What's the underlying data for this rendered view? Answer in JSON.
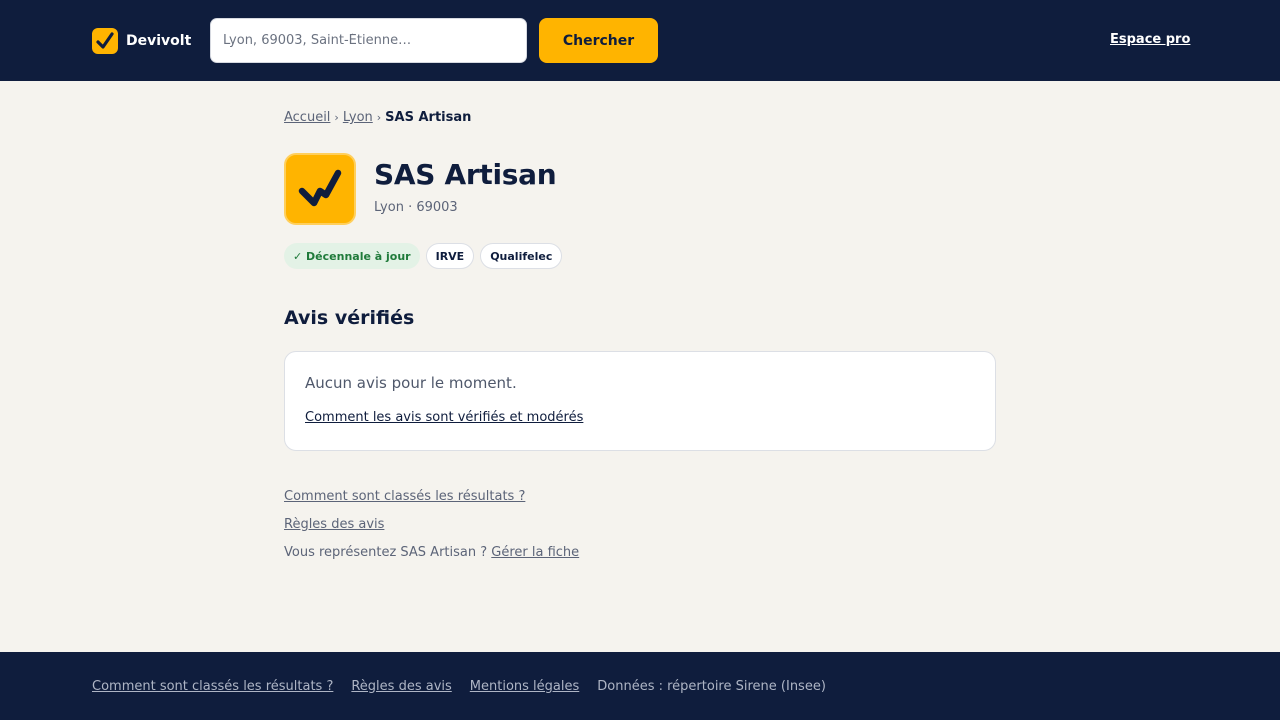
{
  "colors": {
    "navy": "#0f1d3d",
    "accent": "#ffb400",
    "background": "#f5f3ee",
    "success": "#1f7a3a"
  },
  "header": {
    "brand_name": "Devivolt",
    "logo_icon": "check-bolt-icon",
    "search_placeholder": "Lyon, 69003, Saint-Étienne…",
    "search_value": "",
    "search_button": "Chercher",
    "pro_link": "Espace pro"
  },
  "breadcrumb": {
    "home": "Accueil",
    "separator_1": "›",
    "city": "Lyon",
    "separator_2": "›",
    "current": "SAS Artisan"
  },
  "company": {
    "name": "SAS Artisan",
    "location": "Lyon · 69003",
    "logo_icon": "check-bolt-icon",
    "badges": {
      "decennale": "✓ Décennale à jour",
      "irve": "IRVE",
      "qualifelec": "Qualifelec"
    }
  },
  "reviews": {
    "title": "Avis vérifiés",
    "empty_text": "Aucun avis pour le moment.",
    "how_link": "Comment les avis sont vérifiés et modérés"
  },
  "links": {
    "ranking": "Comment sont classés les résultats ?",
    "rules": "Règles des avis",
    "represent_text": "Vous représentez SAS Artisan ?",
    "manage": "Gérer la fiche"
  },
  "footer": {
    "ranking": "Comment sont classés les résultats ?",
    "rules": "Règles des avis",
    "legal": "Mentions légales",
    "data_source": "Données : répertoire Sirene (Insee)"
  }
}
